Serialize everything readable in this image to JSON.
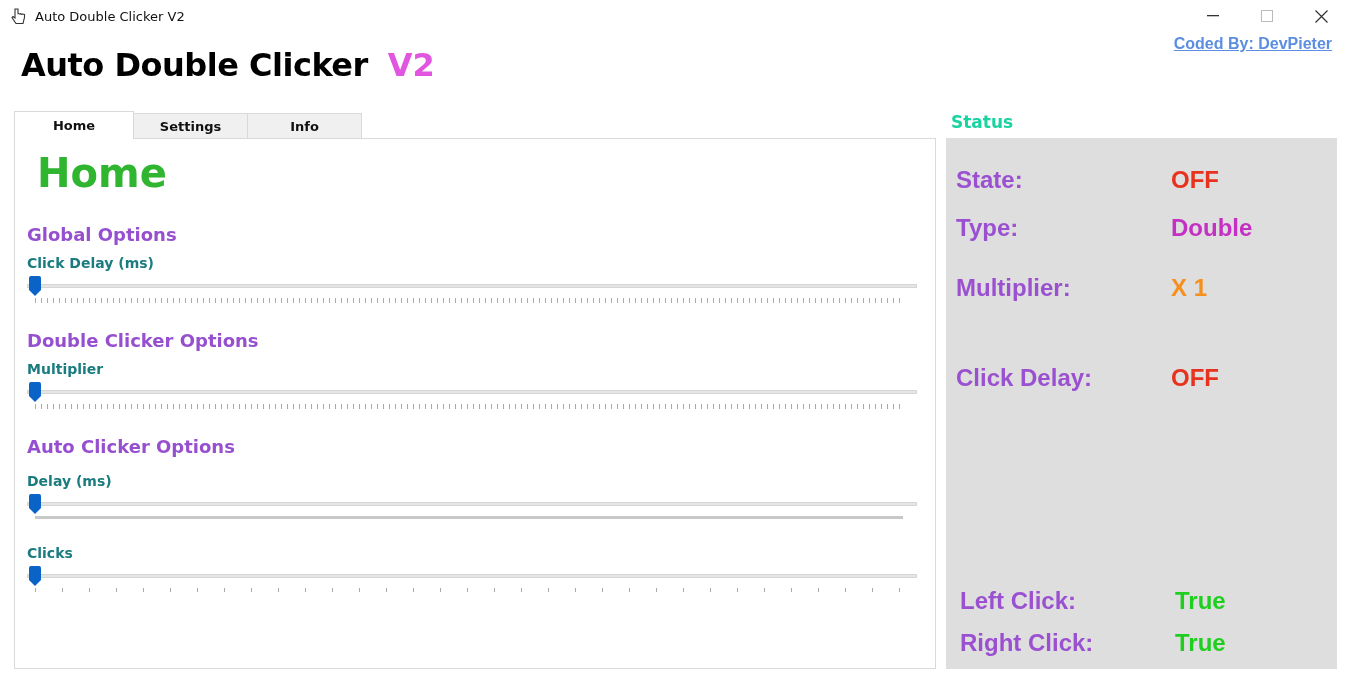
{
  "window": {
    "title": "Auto Double Clicker V2"
  },
  "header": {
    "title": "Auto Double Clicker",
    "version": "V2",
    "link": "Coded By: DevPieter"
  },
  "tabs": [
    {
      "label": "Home",
      "selected": true
    },
    {
      "label": "Settings",
      "selected": false
    },
    {
      "label": "Info",
      "selected": false
    }
  ],
  "page": {
    "heading": "Home",
    "sections": [
      {
        "heading": "Global Options",
        "sliders": [
          {
            "label": "Click Delay (ms)",
            "level": 0,
            "kind": "dense"
          }
        ]
      },
      {
        "heading": "Double Clicker Options",
        "sliders": [
          {
            "label": "Multiplier",
            "level": 0,
            "kind": "dense"
          }
        ]
      },
      {
        "heading": "Auto Clicker Options",
        "sliders": [
          {
            "label": "Delay (ms)",
            "level": 0,
            "kind": "solid"
          },
          {
            "label": "Clicks",
            "level": 0,
            "kind": "sparse"
          }
        ]
      }
    ]
  },
  "status": {
    "title": "Status",
    "rows": [
      {
        "label": "State:",
        "value": "OFF",
        "color": "#e8321e"
      },
      {
        "label": "Type:",
        "value": "Double",
        "color": "#c42fc4"
      },
      {
        "label": "Multiplier:",
        "value": "X 1",
        "color": "#f5901e"
      },
      {
        "label": "Click Delay:",
        "value": "OFF",
        "color": "#e8321e"
      }
    ],
    "bottom_rows": [
      {
        "label": "Left Click:",
        "value": "True",
        "color": "#1fcf1f"
      },
      {
        "label": "Right Click:",
        "value": "True",
        "color": "#1fcf1f"
      }
    ]
  }
}
